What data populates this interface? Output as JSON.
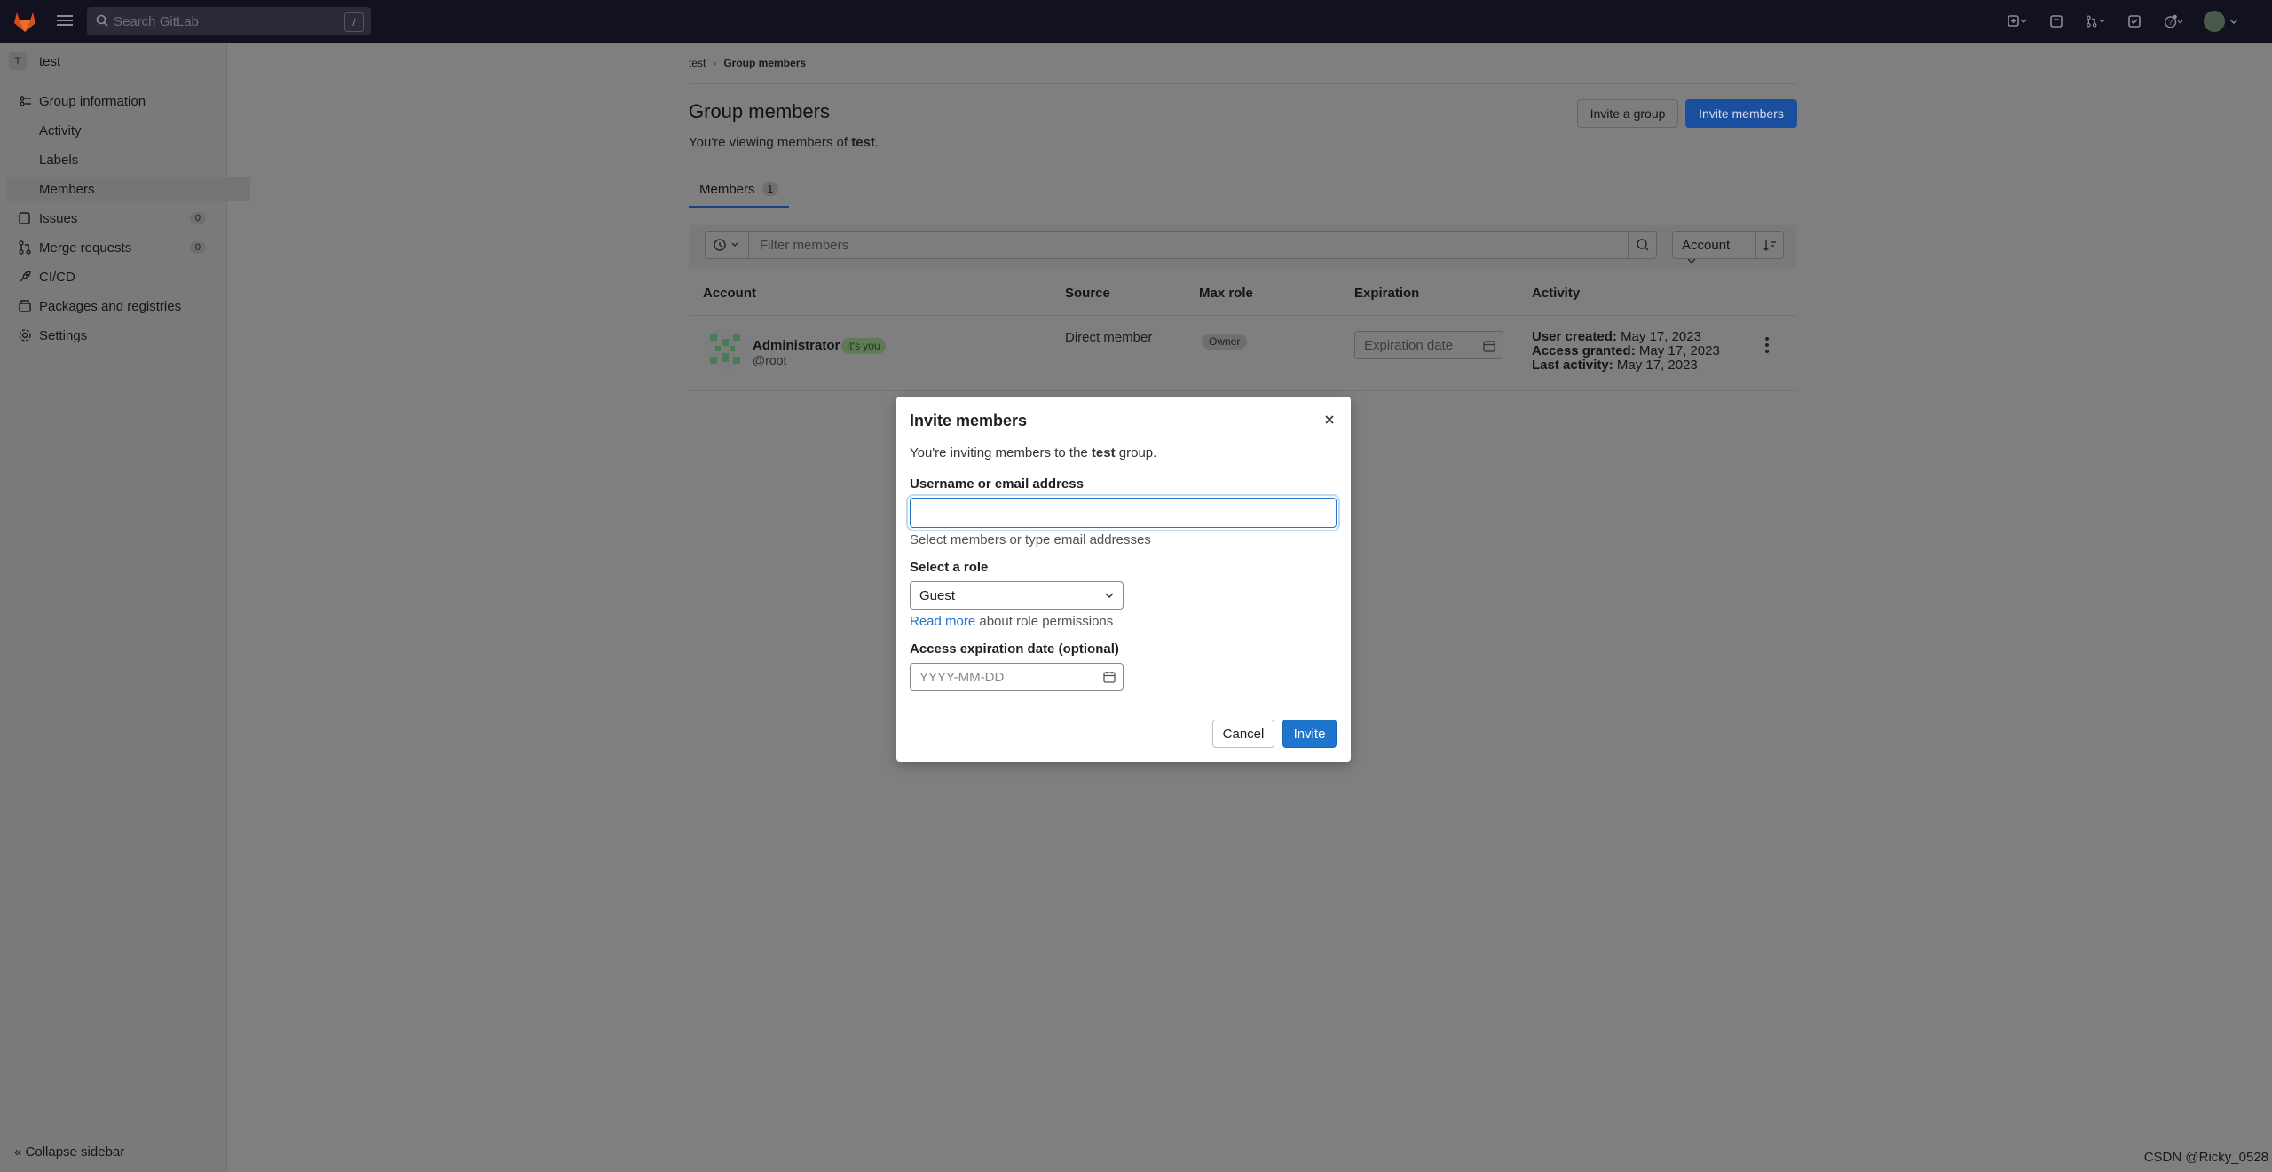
{
  "topbar": {
    "search_placeholder": "Search GitLab",
    "search_shortcut": "/"
  },
  "sidebar": {
    "group_initial": "T",
    "group_name": "test",
    "items": [
      {
        "label": "Group information",
        "icon": "group-info-icon"
      },
      {
        "label": "Activity"
      },
      {
        "label": "Labels"
      },
      {
        "label": "Members"
      },
      {
        "label": "Issues",
        "badge": "0",
        "icon": "issues-icon"
      },
      {
        "label": "Merge requests",
        "badge": "0",
        "icon": "merge-request-icon"
      },
      {
        "label": "CI/CD",
        "icon": "rocket-icon"
      },
      {
        "label": "Packages and registries",
        "icon": "package-icon"
      },
      {
        "label": "Settings",
        "icon": "gear-icon"
      }
    ],
    "collapse_label": "Collapse sidebar"
  },
  "breadcrumb": {
    "root": "test",
    "current": "Group members"
  },
  "page": {
    "title": "Group members",
    "subtitle_prefix": "You're viewing members of ",
    "subtitle_group": "test",
    "subtitle_suffix": ".",
    "invite_group_label": "Invite a group",
    "invite_members_label": "Invite members",
    "tab_label": "Members",
    "tab_count": "1",
    "filter_placeholder": "Filter members",
    "sort_label": "Account"
  },
  "table": {
    "headers": [
      "Account",
      "Source",
      "Max role",
      "Expiration",
      "Activity"
    ],
    "row": {
      "name": "Administrator",
      "you_badge": "It's you",
      "handle": "@root",
      "source": "Direct member",
      "role": "Owner",
      "expiration_placeholder": "Expiration date",
      "activity": [
        {
          "label": "User created:",
          "value": "May 17, 2023"
        },
        {
          "label": "Access granted:",
          "value": "May 17, 2023"
        },
        {
          "label": "Last activity:",
          "value": "May 17, 2023"
        }
      ]
    }
  },
  "modal": {
    "title": "Invite members",
    "intro_prefix": "You're inviting members to the ",
    "intro_group": "test",
    "intro_suffix": " group.",
    "username_label": "Username or email address",
    "username_value": "",
    "username_help": "Select members or type email addresses",
    "role_label": "Select a role",
    "role_value": "Guest",
    "role_link": "Read more",
    "role_help_suffix": " about role permissions",
    "date_label": "Access expiration date (optional)",
    "date_placeholder": "YYYY-MM-DD",
    "cancel_label": "Cancel",
    "invite_label": "Invite"
  },
  "watermark": "CSDN @Ricky_0528",
  "colors": {
    "accent": "#1f75cb",
    "topbar": "#121120"
  }
}
